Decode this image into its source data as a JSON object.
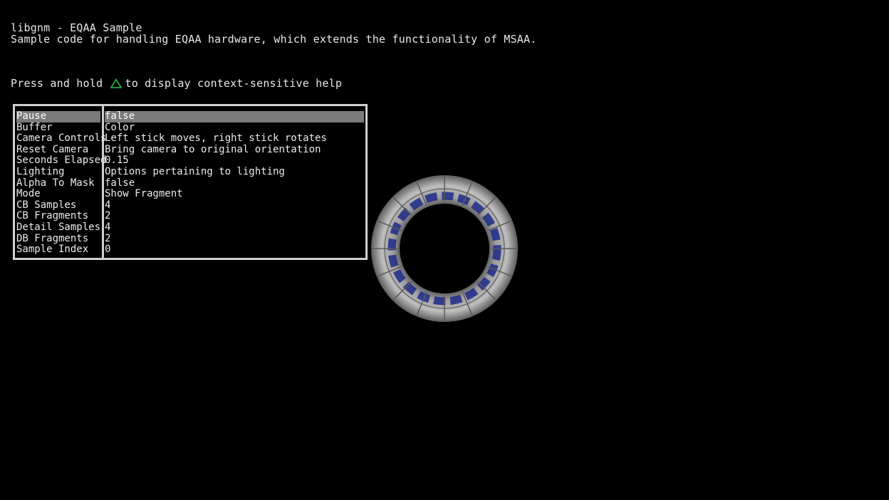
{
  "header": {
    "title": "libgnm - EQAA Sample",
    "subtitle": "Sample code for handling EQAA hardware, which extends the functionality of MSAA.",
    "help_prefix": "Press and hold",
    "help_icon": "triangle-button-icon",
    "help_suffix": "to display context-sensitive help"
  },
  "menu": {
    "selected_index": 0,
    "items": [
      {
        "label": "Pause",
        "value": "false"
      },
      {
        "label": "Buffer",
        "value": "Color"
      },
      {
        "label": "Camera Controls",
        "value": "Left stick moves, right stick rotates"
      },
      {
        "label": "Reset Camera",
        "value": "Bring camera to original orientation"
      },
      {
        "label": "Seconds Elapsed",
        "value": "0.15"
      },
      {
        "label": "Lighting",
        "value": "Options pertaining to lighting"
      },
      {
        "label": "Alpha To Mask",
        "value": "false"
      },
      {
        "label": "Mode",
        "value": "Show Fragment"
      },
      {
        "label": "CB Samples",
        "value": "4"
      },
      {
        "label": "CB Fragments",
        "value": "2"
      },
      {
        "label": "Detail Samples",
        "value": "4"
      },
      {
        "label": "DB Fragments",
        "value": "2"
      },
      {
        "label": "Sample Index",
        "value": "0"
      }
    ]
  },
  "colors": {
    "background": "#000000",
    "text": "#e8e8e8",
    "menu_border": "#cfcfcf",
    "selection": "#7a7a7a",
    "triangle_icon": "#1fa83a",
    "torus_gray": "#8c8c8c",
    "torus_text": "#1e2a8a"
  }
}
